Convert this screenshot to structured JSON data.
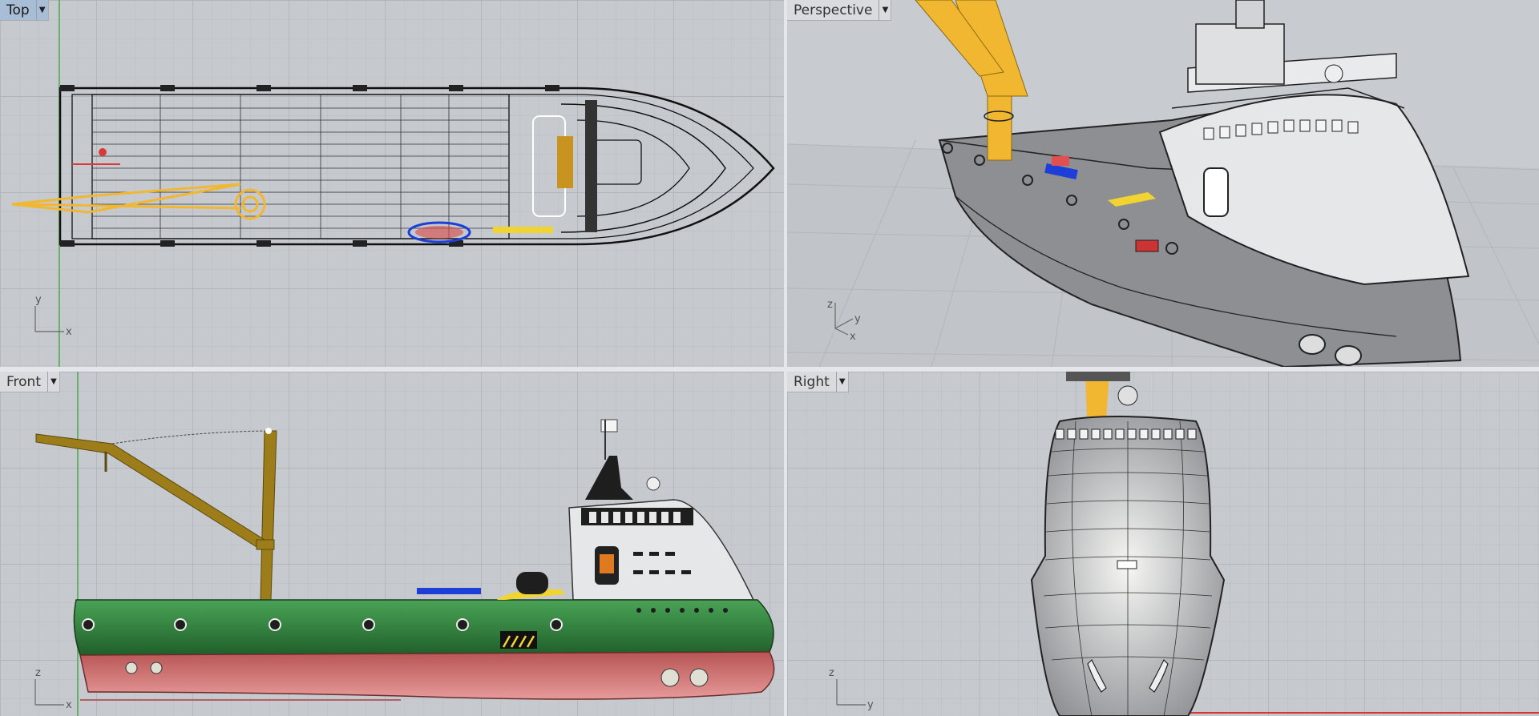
{
  "viewports": {
    "top": {
      "label": "Top",
      "active": true,
      "axis_a": "y",
      "axis_b": "x"
    },
    "perspective": {
      "label": "Perspective",
      "active": false,
      "axis_a": "z",
      "axis_b": "y",
      "axis_c": "x"
    },
    "front": {
      "label": "Front",
      "active": false,
      "axis_a": "z",
      "axis_b": "x"
    },
    "right": {
      "label": "Right",
      "active": false,
      "axis_a": "z",
      "axis_b": "y"
    }
  },
  "dropdown_icon": "chevron-down-icon",
  "colors": {
    "grid_bg": "#c6c9ce",
    "grid_line": "#b3b7bd",
    "crane": "#f2b731",
    "hull_green": "#2e7d3a",
    "hull_red": "#c96b6b",
    "active_tab": "#a8bdd6"
  }
}
